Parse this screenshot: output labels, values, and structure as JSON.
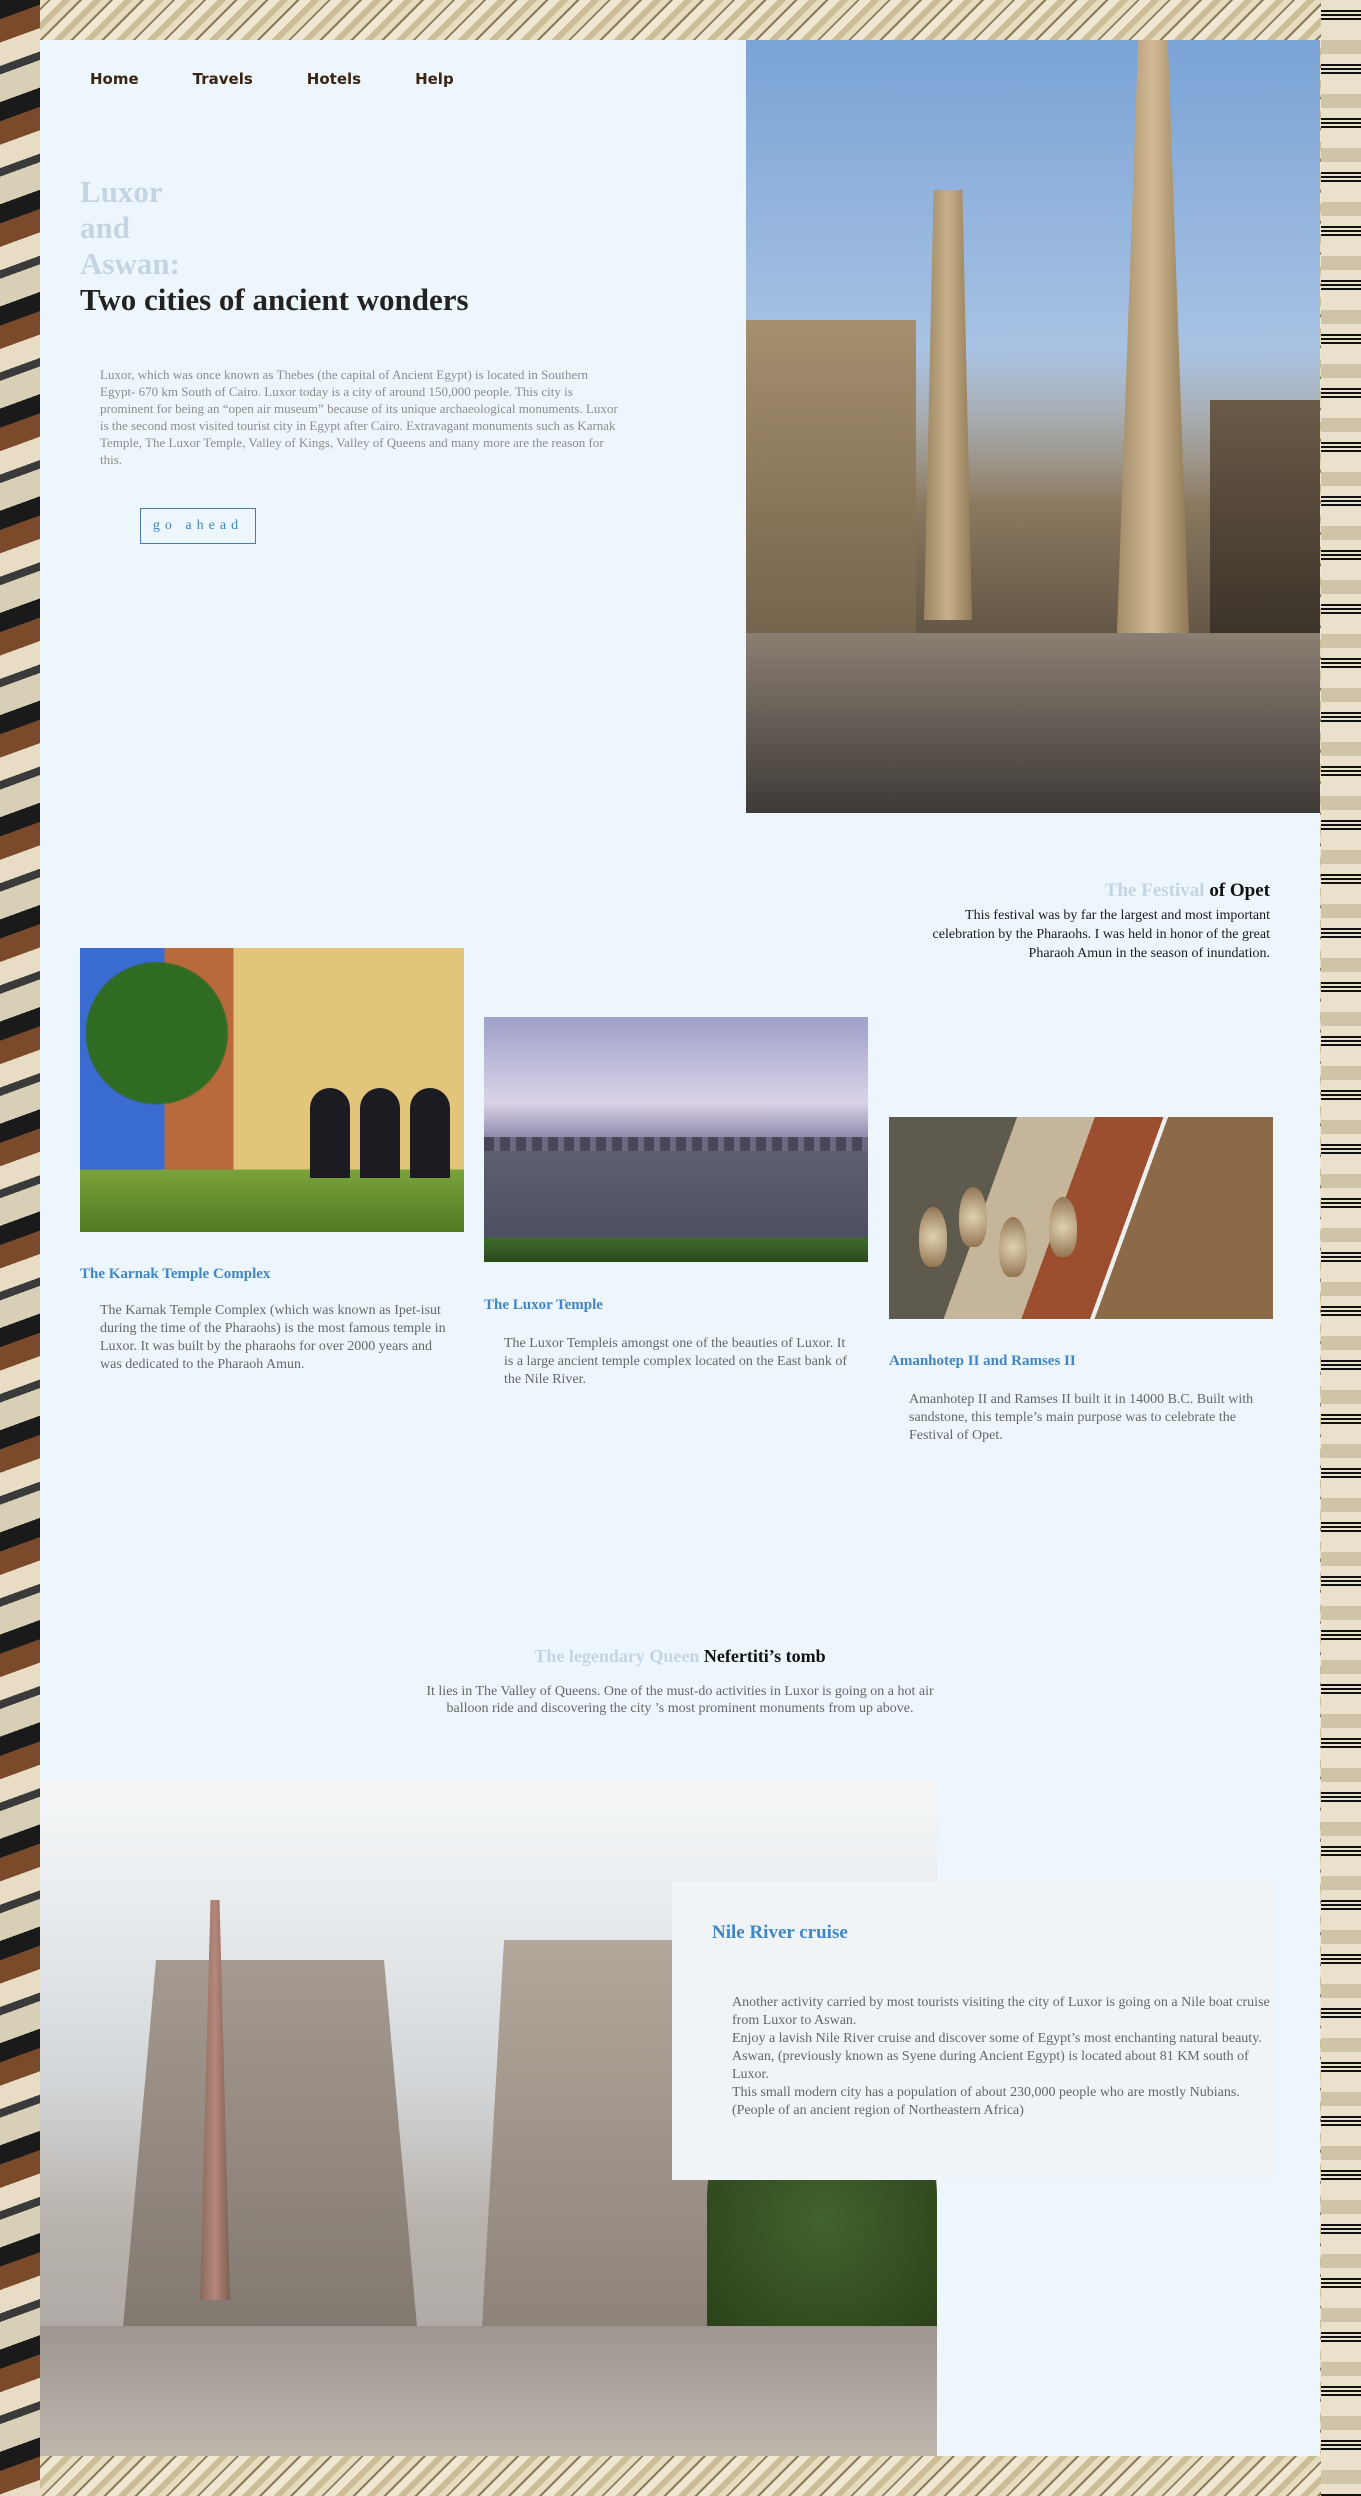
{
  "nav": {
    "items": [
      "Home",
      "Travels",
      "Hotels",
      "Help"
    ]
  },
  "hero": {
    "title_pale_lines": [
      "Luxor",
      "and",
      "Aswan:"
    ],
    "title_dark": "Two cities of ancient wonders",
    "description": "Luxor, which was once known as Thebes (the capital of Ancient Egypt) is located in Southern Egypt- 670 km South of Cairo. Luxor today is a city of around 150,000 people. This city is prominent for being an “open air museum” because of its unique archaeological monuments. Luxor is the second most visited tourist city in Egypt after Cairo. Extravagant monuments such as Karnak Temple, The Luxor Temple, Valley of Kings, Valley of Queens and many more are the reason for this.",
    "button_label": "go ahead"
  },
  "festival": {
    "title_pale": "The Festival",
    "title_dark": "of Opet",
    "text": "This festival was by far the largest and most important celebration by the Pharaohs. I was held in honor of the great Pharaoh Amun in the season of inundation."
  },
  "cards": [
    {
      "title": "The Karnak Temple Complex",
      "text": "The Karnak Temple Complex (which was known as Ipet-isut during the time of the Pharaohs) is the most famous temple in Luxor. It was built by the pharaohs for over 2000 years and was dedicated to the Pharaoh Amun."
    },
    {
      "title": "The Luxor Temple",
      "text": "The Luxor Templeis amongst one of the beauties of Luxor. It is a large ancient temple complex located on the East bank of the Nile River."
    },
    {
      "title": "Amanhotep II and Ramses II",
      "text": "Amanhotep II and Ramses II built it in 14000 B.C. Built with sandstone, this temple’s main purpose was to celebrate the Festival of Opet."
    }
  ],
  "queen": {
    "title_pale": "The legendary Queen",
    "title_dark": "Nefertiti’s tomb",
    "text": "It lies in The Valley of Queens. One of the must-do activities in Luxor is going on a hot air balloon ride and discovering the city ’s most prominent monuments from up above."
  },
  "cruise": {
    "title": "Nile River cruise",
    "text": "Another activity carried by most tourists visiting the city of Luxor is going on a Nile boat cruise from Luxor to Aswan.\nEnjoy a lavish Nile River cruise and discover some of Egypt’s most enchanting natural beauty.\nAswan, (previously known as Syene during Ancient Egypt) is located about 81 KM south of Luxor.\nThis small modern city has a population of about 230,000 people who are mostly Nubians. (People of an ancient region of Northeastern Africa)"
  }
}
